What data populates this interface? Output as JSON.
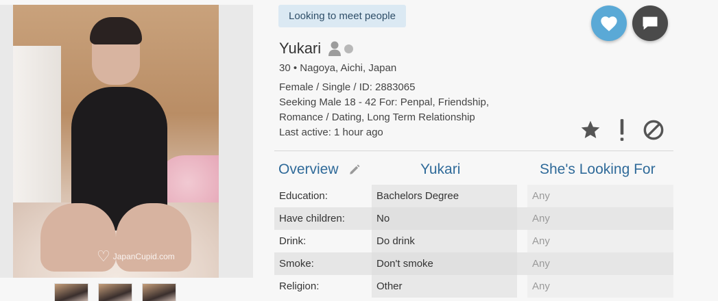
{
  "photo": {
    "watermark": "JapanCupid.com",
    "thumbnails": [
      "thumb-1",
      "thumb-2",
      "thumb-3"
    ]
  },
  "profile": {
    "status_badge": "Looking to meet people",
    "name": "Yukari",
    "age_location": "30 • Nagoya, Aichi, Japan",
    "details_line1": "Female / Single / ID: 2883065",
    "details_line2": "Seeking Male 18 - 42 For: Penpal, Friendship,",
    "details_line3": "Romance / Dating, Long Term Relationship",
    "last_active": "Last active: 1 hour ago"
  },
  "icons": {
    "like": "heart-icon",
    "message": "chat-bubble-icon",
    "favorite": "star-icon",
    "report": "exclamation-icon",
    "block": "block-icon",
    "edit": "pencil-icon",
    "online": "user-icon"
  },
  "tabs": {
    "overview": "Overview",
    "name": "Yukari",
    "looking_for": "She's Looking For"
  },
  "table": [
    {
      "label": "Education:",
      "value": "Bachelors Degree",
      "seeking": "Any"
    },
    {
      "label": "Have children:",
      "value": "No",
      "seeking": "Any"
    },
    {
      "label": "Drink:",
      "value": "Do drink",
      "seeking": "Any"
    },
    {
      "label": "Smoke:",
      "value": "Don't smoke",
      "seeking": "Any"
    },
    {
      "label": "Religion:",
      "value": "Other",
      "seeking": "Any"
    }
  ],
  "colors": {
    "accent": "#2f6a99",
    "like": "#5aa9d6",
    "message": "#4a4a4a",
    "badge_bg": "#dbe9f3"
  }
}
